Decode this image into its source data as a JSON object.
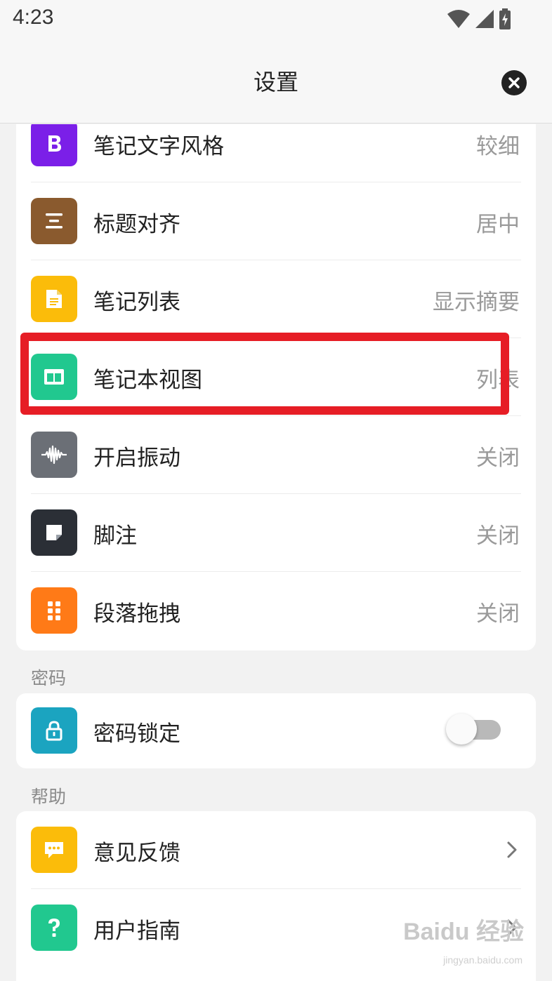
{
  "status_bar": {
    "time": "4:23"
  },
  "header": {
    "title": "设置"
  },
  "display_rows": [
    {
      "label": "笔记文字风格",
      "value": "较细",
      "icon": "bold-b-icon",
      "color": "#7b1fe8"
    },
    {
      "label": "标题对齐",
      "value": "居中",
      "icon": "align-center-icon",
      "color": "#8a5a2e"
    },
    {
      "label": "笔记列表",
      "value": "显示摘要",
      "icon": "document-icon",
      "color": "#fbbc0a"
    },
    {
      "label": "笔记本视图",
      "value": "列表",
      "icon": "columns-icon",
      "color": "#21c88f"
    },
    {
      "label": "开启振动",
      "value": "关闭",
      "icon": "waveform-icon",
      "color": "#6b6f76"
    },
    {
      "label": "脚注",
      "value": "关闭",
      "icon": "note-icon",
      "color": "#2b2f36"
    },
    {
      "label": "段落拖拽",
      "value": "关闭",
      "icon": "drag-dots-icon",
      "color": "#ff7a17"
    }
  ],
  "password_section": {
    "title": "密码",
    "row": {
      "label": "密码锁定",
      "icon": "lock-icon",
      "color": "#1ba4c0",
      "toggle": false
    }
  },
  "help_section": {
    "title": "帮助",
    "rows": [
      {
        "label": "意见反馈",
        "icon": "chat-bubble-icon",
        "color": "#fbbc0a"
      },
      {
        "label": "用户指南",
        "icon": "question-icon",
        "color": "#21c88f"
      }
    ]
  },
  "watermark": {
    "brand": "Baidu 经验",
    "url": "jingyan.baidu.com"
  },
  "colors": {
    "highlight": "#e61d25",
    "background": "#f2f2f2"
  }
}
